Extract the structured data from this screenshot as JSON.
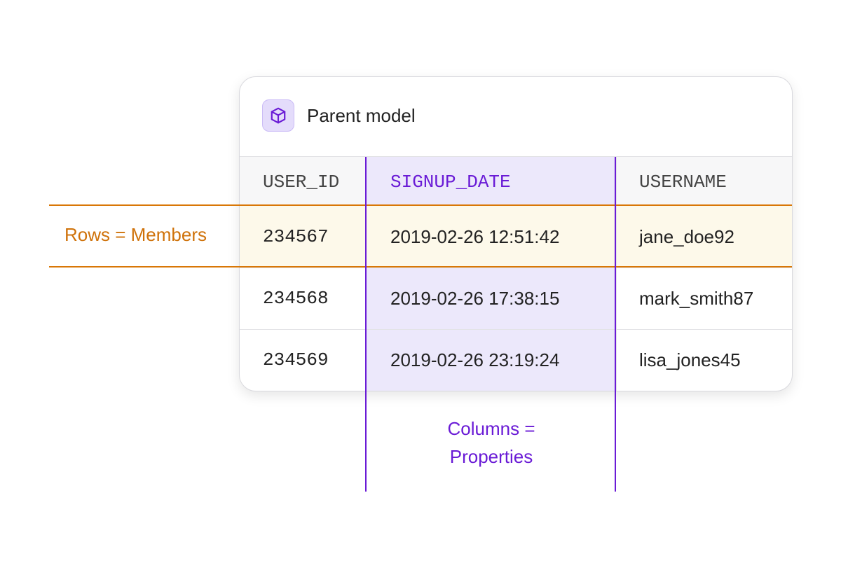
{
  "card": {
    "title": "Parent model",
    "icon": "cube-icon"
  },
  "table": {
    "columns": [
      "USER_ID",
      "SIGNUP_DATE",
      "USERNAME"
    ],
    "rows": [
      [
        "234567",
        "2019-02-26 12:51:42",
        "jane_doe92"
      ],
      [
        "234568",
        "2019-02-26 17:38:15",
        "mark_smith87"
      ],
      [
        "234569",
        "2019-02-26 23:19:24",
        "lisa_jones45"
      ]
    ]
  },
  "annotations": {
    "rows_label": "Rows = Members",
    "columns_label_line1": "Columns =",
    "columns_label_line2": "Properties"
  },
  "colors": {
    "rows_accent": "#d97706",
    "columns_accent": "#6a1bd6",
    "highlight_row_bg": "#fdf9ea",
    "highlight_col_bg": "#ece8fb"
  }
}
